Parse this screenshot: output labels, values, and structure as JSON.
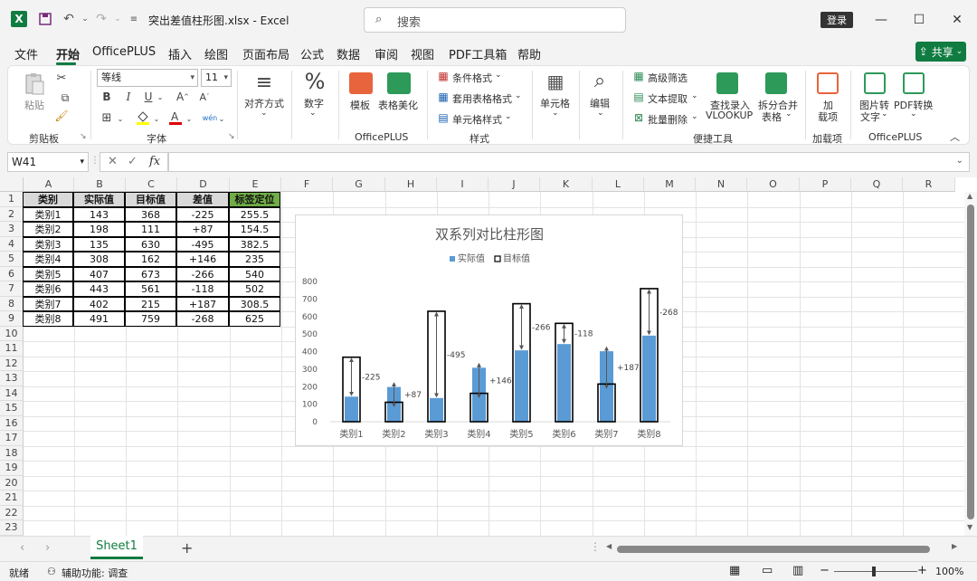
{
  "titlebar": {
    "autosave_icon": "save-icon",
    "undo_icon": "undo-icon",
    "redo_icon": "redo-icon",
    "filename": "突出差值柱形图.xlsx",
    "separator": "-",
    "app": "Excel",
    "search_placeholder": "搜索",
    "login": "登录"
  },
  "menu": {
    "tabs": [
      "文件",
      "开始",
      "OfficePLUS",
      "插入",
      "绘图",
      "页面布局",
      "公式",
      "数据",
      "审阅",
      "视图",
      "PDF工具箱",
      "帮助"
    ],
    "active": "开始",
    "share": "共享"
  },
  "ribbon": {
    "clipboard": {
      "paste": "粘贴",
      "group": "剪贴板"
    },
    "font": {
      "name": "等线",
      "size": "11",
      "group": "字体",
      "bold": "B",
      "italic": "I",
      "underline": "U",
      "grow": "A",
      "shrink": "A"
    },
    "align": {
      "label": "对齐方式"
    },
    "number": {
      "label": "数字"
    },
    "officeplus": {
      "template": "模板",
      "beautify": "表格美化",
      "group": "OfficePLUS"
    },
    "styles": {
      "cond_format": "条件格式",
      "table_format": "套用表格格式",
      "cell_style": "单元格样式",
      "group": "样式"
    },
    "cells": {
      "label": "单元格"
    },
    "edit": {
      "label": "编辑"
    },
    "tools": {
      "adv_filter": "高级筛选",
      "text_extract": "文本提取",
      "batch_delete": "批量删除",
      "lookup_line1": "查找录入",
      "lookup_line2": "VLOOKUP",
      "split_line1": "拆分合并",
      "split_line2": "表格",
      "group": "便捷工具"
    },
    "addins": {
      "line1": "加",
      "line2": "载项",
      "group": "加载项"
    },
    "officeplus2": {
      "img2text_line1": "图片转",
      "img2text_line2": "文字",
      "pdf_line1": "PDF转换",
      "group": "OfficePLUS"
    }
  },
  "formula": {
    "namebox": "W41",
    "fx": "fx",
    "value": ""
  },
  "columns": [
    "A",
    "B",
    "C",
    "D",
    "E",
    "F",
    "G",
    "H",
    "I",
    "J",
    "K",
    "L",
    "M",
    "N",
    "O",
    "P",
    "Q",
    "R"
  ],
  "rows": [
    "1",
    "2",
    "3",
    "4",
    "5",
    "6",
    "7",
    "8",
    "9",
    "10",
    "11",
    "12",
    "13",
    "14",
    "15",
    "16",
    "17",
    "18",
    "19",
    "20",
    "21",
    "22",
    "23"
  ],
  "table": {
    "headers": [
      "类别",
      "实际值",
      "目标值",
      "差值",
      "标签定位"
    ],
    "rows": [
      [
        "类别1",
        "143",
        "368",
        "-225",
        "255.5"
      ],
      [
        "类别2",
        "198",
        "111",
        "+87",
        "154.5"
      ],
      [
        "类别3",
        "135",
        "630",
        "-495",
        "382.5"
      ],
      [
        "类别4",
        "308",
        "162",
        "+146",
        "235"
      ],
      [
        "类别5",
        "407",
        "673",
        "-266",
        "540"
      ],
      [
        "类别6",
        "443",
        "561",
        "-118",
        "502"
      ],
      [
        "类别7",
        "402",
        "215",
        "+187",
        "308.5"
      ],
      [
        "类别8",
        "491",
        "759",
        "-268",
        "625"
      ]
    ],
    "header_highlight": "#70ad47"
  },
  "chart_data": {
    "type": "bar",
    "title": "双系列对比柱形图",
    "categories": [
      "类别1",
      "类别2",
      "类别3",
      "类别4",
      "类别5",
      "类别6",
      "类别7",
      "类别8"
    ],
    "series": [
      {
        "name": "实际值",
        "values": [
          143,
          198,
          135,
          308,
          407,
          443,
          402,
          491
        ],
        "color": "#5b9bd5"
      },
      {
        "name": "目标值",
        "values": [
          368,
          111,
          630,
          162,
          673,
          561,
          215,
          759
        ],
        "color": "#000000"
      }
    ],
    "diff_labels": [
      "-225",
      "+87",
      "-495",
      "+146",
      "-266",
      "-118",
      "+187",
      "-268"
    ],
    "yticks": [
      "0",
      "100",
      "200",
      "300",
      "400",
      "500",
      "600",
      "700",
      "800"
    ],
    "ylim": [
      0,
      800
    ],
    "legend": "top"
  },
  "sheets": {
    "tabs": [
      "Sheet1"
    ],
    "add": "+"
  },
  "status": {
    "ready": "就绪",
    "accessibility": "辅助功能: 调查",
    "zoom": "100%"
  }
}
